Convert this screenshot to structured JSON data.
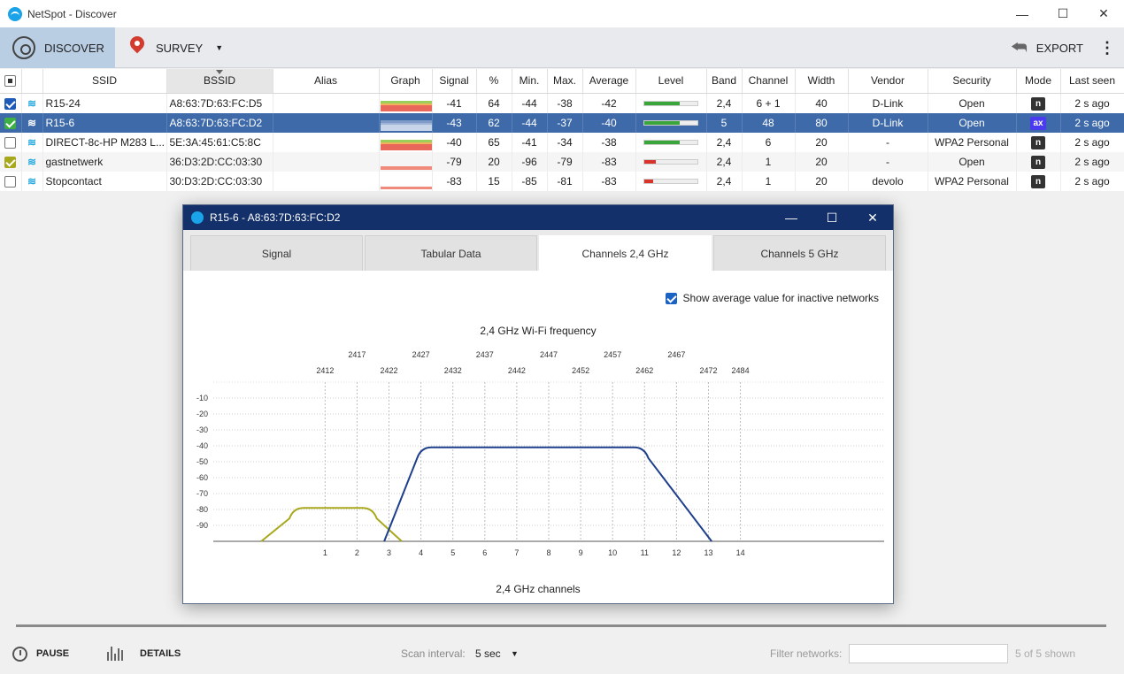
{
  "window": {
    "title": "NetSpot - Discover"
  },
  "toolbar": {
    "discover_label": "DISCOVER",
    "survey_label": "SURVEY",
    "export_label": "EXPORT"
  },
  "table": {
    "columns": [
      "SSID",
      "BSSID",
      "Alias",
      "Graph",
      "Signal",
      "%",
      "Min.",
      "Max.",
      "Average",
      "Level",
      "Band",
      "Channel",
      "Width",
      "Vendor",
      "Security",
      "Mode",
      "Last seen"
    ],
    "rows": [
      {
        "checked": true,
        "check_color": "#1e5bb8",
        "ssid": "R15-24",
        "bssid": "A8:63:7D:63:FC:D5",
        "alias": "",
        "signal": "-41",
        "percent": "64",
        "min": "-44",
        "max": "-38",
        "average": "-42",
        "level": 0.66,
        "level_color": "#3aa53a",
        "band": "2,4",
        "channel": "6 + 1",
        "width": "40",
        "vendor": "D-Link",
        "security": "Open",
        "mode": "n",
        "last_seen": "2 s ago"
      },
      {
        "checked": true,
        "check_color": "#3cb043",
        "ssid": "R15-6",
        "bssid": "A8:63:7D:63:FC:D2",
        "alias": "",
        "signal": "-43",
        "percent": "62",
        "min": "-44",
        "max": "-37",
        "average": "-40",
        "level": 0.66,
        "level_color": "#3aa53a",
        "band": "5",
        "channel": "48",
        "width": "80",
        "vendor": "D-Link",
        "security": "Open",
        "mode": "ax",
        "last_seen": "2 s ago"
      },
      {
        "checked": false,
        "check_color": "#ffffff",
        "ssid": "DIRECT-8c-HP M283 L...",
        "bssid": "5E:3A:45:61:C5:8C",
        "alias": "",
        "signal": "-40",
        "percent": "65",
        "min": "-41",
        "max": "-34",
        "average": "-38",
        "level": 0.66,
        "level_color": "#3aa53a",
        "band": "2,4",
        "channel": "6",
        "width": "20",
        "vendor": "-",
        "security": "WPA2 Personal",
        "mode": "n",
        "last_seen": "2 s ago"
      },
      {
        "checked": true,
        "check_color": "#a8a81c",
        "ssid": "gastnetwerk",
        "bssid": "36:D3:2D:CC:03:30",
        "alias": "",
        "signal": "-79",
        "percent": "20",
        "min": "-96",
        "max": "-79",
        "average": "-83",
        "level": 0.22,
        "level_color": "#d9342b",
        "band": "2,4",
        "channel": "1",
        "width": "20",
        "vendor": "-",
        "security": "Open",
        "mode": "n",
        "last_seen": "2 s ago"
      },
      {
        "checked": false,
        "check_color": "#ffffff",
        "ssid": "Stopcontact",
        "bssid": "30:D3:2D:CC:03:30",
        "alias": "",
        "signal": "-83",
        "percent": "15",
        "min": "-85",
        "max": "-81",
        "average": "-83",
        "level": 0.16,
        "level_color": "#d9342b",
        "band": "2,4",
        "channel": "1",
        "width": "20",
        "vendor": "devolo",
        "security": "WPA2 Personal",
        "mode": "n",
        "last_seen": "2 s ago"
      }
    ]
  },
  "dialog": {
    "title": "R15-6 - A8:63:7D:63:FC:D2",
    "tabs": [
      "Signal",
      "Tabular Data",
      "Channels 2,4 GHz",
      "Channels 5 GHz"
    ],
    "active_tab": 2,
    "avg_toggle_label": "Show average value for inactive networks"
  },
  "chart_data": {
    "type": "line",
    "title": "2,4 GHz Wi-Fi frequency",
    "xlabel": "2,4 GHz channels",
    "channels": [
      1,
      2,
      3,
      4,
      5,
      6,
      7,
      8,
      9,
      10,
      11,
      12,
      13,
      14
    ],
    "frequencies_top": [
      "2417",
      "2427",
      "2437",
      "2447",
      "2457",
      "2467"
    ],
    "frequencies_top_channels": [
      2,
      4,
      6,
      8,
      10,
      12
    ],
    "frequencies_bottom": [
      "2412",
      "2422",
      "2432",
      "2442",
      "2452",
      "2462",
      "2472",
      "2484"
    ],
    "frequencies_bottom_channels": [
      1,
      3,
      5,
      7,
      9,
      11,
      13,
      14
    ],
    "y_ticks": [
      -10,
      -20,
      -30,
      -40,
      -50,
      -60,
      -70,
      -80,
      -90
    ],
    "ylim": [
      -100,
      0
    ],
    "xlim": [
      -2.5,
      18.5
    ],
    "series": [
      {
        "color": "#a8a81c",
        "x": [
          -1,
          0,
          2.5,
          3.4
        ],
        "y": [
          -100,
          -79,
          -79,
          -100
        ]
      },
      {
        "color": "#1e3f8c",
        "x": [
          2.85,
          4,
          11,
          13.1
        ],
        "y": [
          -100,
          -41,
          -41,
          -100
        ]
      }
    ]
  },
  "bottombar": {
    "pause_label": "PAUSE",
    "details_label": "DETAILS",
    "scan_interval_label": "Scan interval:",
    "scan_interval_value": "5 sec",
    "filter_label": "Filter networks:",
    "filter_value": "",
    "shown_count": "5 of 5 shown"
  }
}
